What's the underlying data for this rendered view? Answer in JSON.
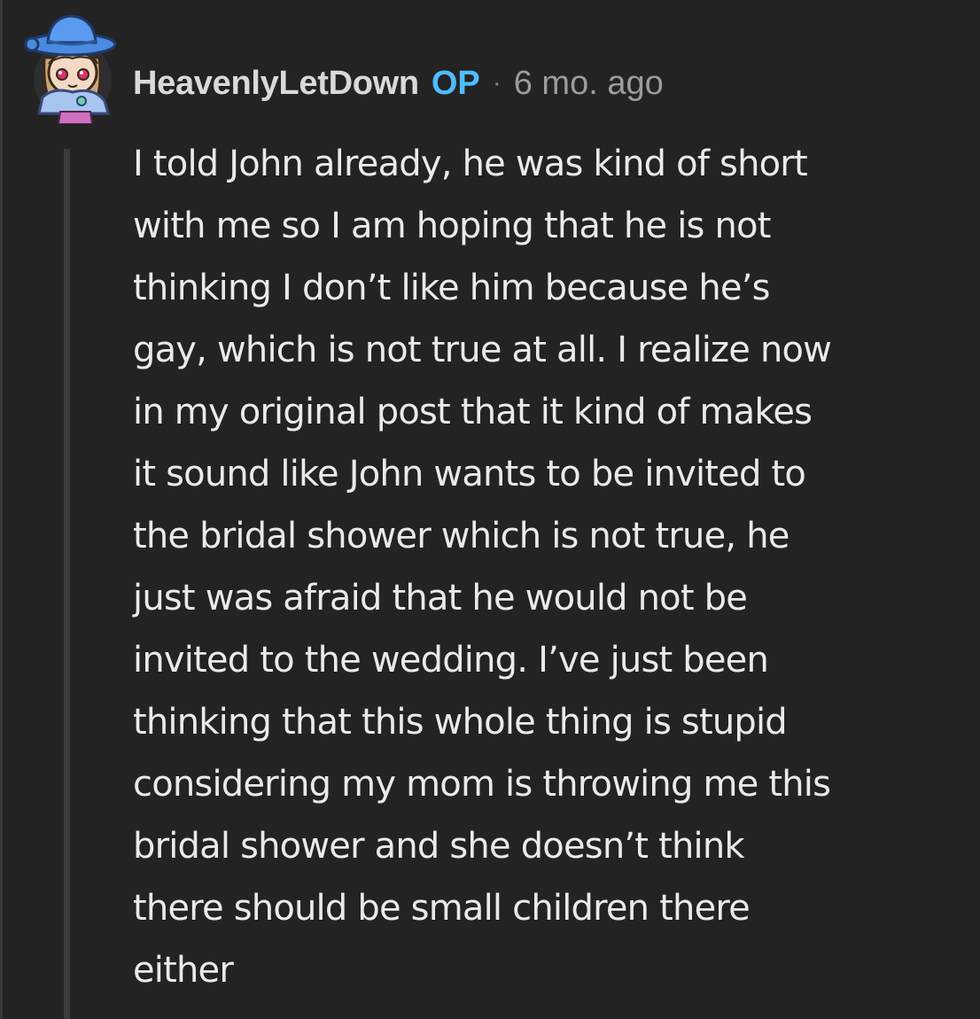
{
  "comment": {
    "author": "HeavenlyLetDown",
    "badge": "OP",
    "separator": "·",
    "timestamp": "6 mo. ago",
    "avatar_icon": "snoo-avatar-blue-hat",
    "body_lines": [
      "I told John already, he was kind of short",
      "with me so I am hoping that he is not",
      "thinking I don’t like him because he’s",
      "gay, which is not true at all. I realize now",
      "in my original post that it kind of makes",
      "it sound like John wants to be invited to",
      "the bridal shower which is not true, he",
      "just was afraid that he would not be",
      "invited to the wedding. I’ve just been",
      "thinking that this whole thing is stupid",
      "considering my mom is throwing me this",
      "bridal shower and she doesn’t think",
      "there should be small children there",
      "either"
    ]
  },
  "colors": {
    "background": "#232324",
    "text": "#e8eaec",
    "op_badge": "#4fbcff",
    "timestamp": "#9a9c9e",
    "thread_line": "#3b3b3d"
  }
}
